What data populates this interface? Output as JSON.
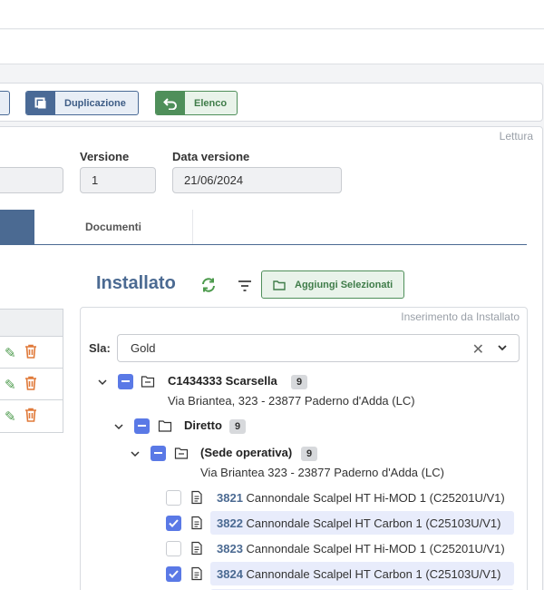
{
  "toolbar": {
    "duplicate_label": "Duplicazione",
    "list_label": "Elenco"
  },
  "panel": {
    "mode_label": "Lettura",
    "fields": {
      "version_label": "Versione",
      "version_value": "1",
      "date_label": "Data versione",
      "date_value": "21/06/2024"
    },
    "tabs": [
      {
        "label": ""
      },
      {
        "label": "Documenti"
      }
    ]
  },
  "installed": {
    "title": "Installato",
    "add_selected_label": "Aggiungi Selezionati",
    "section_label": "Inserimento da Installato",
    "sla_label": "Sla:",
    "sla_value": "Gold",
    "tree": {
      "customer": {
        "code": "C1434333 Scarsella",
        "count": "9",
        "address": "Via Briantea, 323 - 23877 Paderno d'Adda (LC)"
      },
      "direct": {
        "label": "Diretto",
        "count": "9"
      },
      "site": {
        "label": "(Sede operativa)",
        "count": "9",
        "address": "Via Briantea 323 - 23877 Paderno d'Adda (LC)"
      },
      "items": [
        {
          "code": "3821",
          "name": "Cannondale Scalpel HT Hi-MOD 1 (C25201U/V1)",
          "checked": false
        },
        {
          "code": "3822",
          "name": "Cannondale Scalpel HT Carbon 1 (C25103U/V1)",
          "checked": true
        },
        {
          "code": "3823",
          "name": "Cannondale Scalpel HT Hi-MOD 1 (C25201U/V1)",
          "checked": false
        },
        {
          "code": "3824",
          "name": "Cannondale Scalpel HT Carbon 1 (C25103U/V1)",
          "checked": true
        }
      ]
    }
  },
  "colors": {
    "primary": "#4b6a92",
    "success": "#4f8f5a",
    "checkbox": "#5a79e6",
    "danger": "#e07a3a"
  }
}
